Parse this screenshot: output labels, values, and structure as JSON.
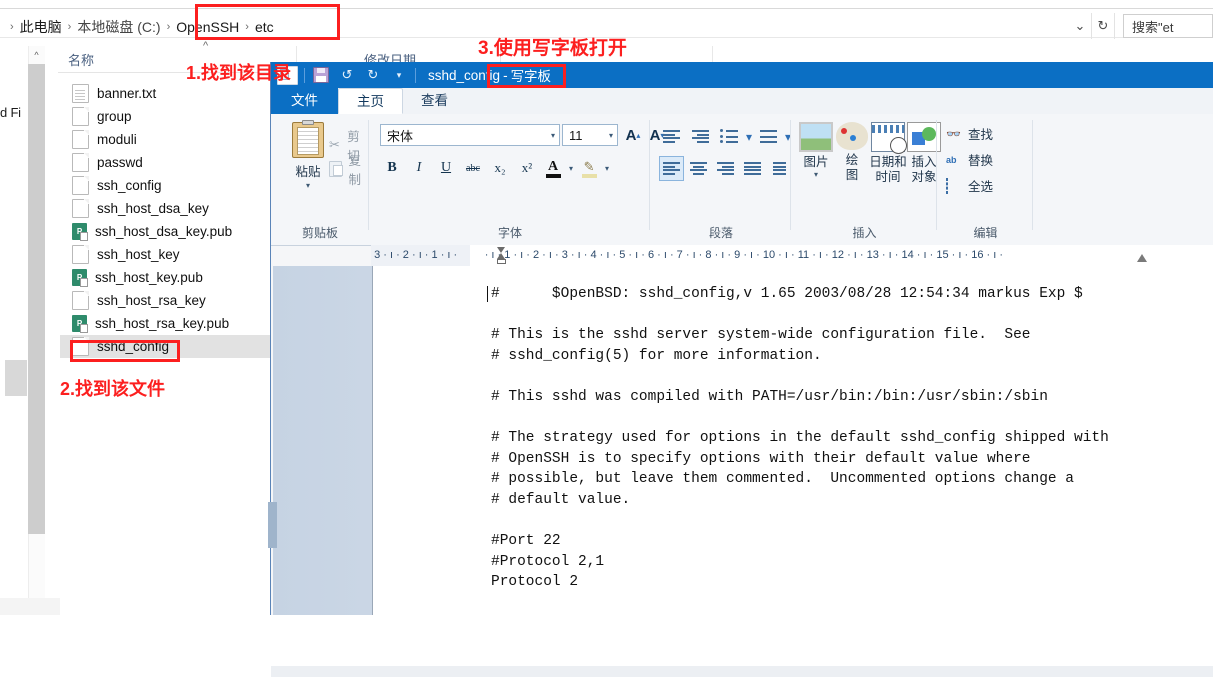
{
  "explorer": {
    "breadcrumb": {
      "leading_sep": "›",
      "items": [
        {
          "label": "此电脑",
          "sep": "›"
        },
        {
          "label": "本地磁盘 (C:)",
          "sep": "›"
        },
        {
          "label": "OpenSSH",
          "sep": "›"
        },
        {
          "label": "etc",
          "sep": ""
        }
      ]
    },
    "address_dropdown_icon": "chevron-down-icon",
    "refresh_icon": "refresh-icon",
    "search": {
      "value": "搜索\"et",
      "placeholder": "搜索\"etc\""
    },
    "columns": {
      "name": "名称",
      "date_modified": "修改日期",
      "sort_caret": "^"
    },
    "nav_partial_text": "d Fi",
    "scroll_up_caret": "^",
    "files": [
      {
        "name": "banner.txt",
        "icon": "text-file-icon",
        "selected": false
      },
      {
        "name": "group",
        "icon": "blank-file-icon",
        "selected": false
      },
      {
        "name": "moduli",
        "icon": "blank-file-icon",
        "selected": false
      },
      {
        "name": "passwd",
        "icon": "blank-file-icon",
        "selected": false
      },
      {
        "name": "ssh_config",
        "icon": "blank-file-icon",
        "selected": false
      },
      {
        "name": "ssh_host_dsa_key",
        "icon": "blank-file-icon",
        "selected": false
      },
      {
        "name": "ssh_host_dsa_key.pub",
        "icon": "pub-file-icon",
        "selected": false
      },
      {
        "name": "ssh_host_key",
        "icon": "blank-file-icon",
        "selected": false
      },
      {
        "name": "ssh_host_key.pub",
        "icon": "pub-file-icon",
        "selected": false
      },
      {
        "name": "ssh_host_rsa_key",
        "icon": "blank-file-icon",
        "selected": false
      },
      {
        "name": "ssh_host_rsa_key.pub",
        "icon": "pub-file-icon",
        "selected": false
      },
      {
        "name": "sshd_config",
        "icon": "blank-file-icon",
        "selected": true
      }
    ]
  },
  "wordpad": {
    "title_doc": "sshd_config",
    "title_sep": " - ",
    "title_app": "写字板",
    "quick_access": {
      "save_icon": "save-icon",
      "undo_icon": "undo-icon",
      "redo_icon": "redo-icon",
      "customize_icon": "chevron-down-icon",
      "undo_glyph": "↺",
      "redo_glyph": "↻",
      "customize_glyph": "▾"
    },
    "tabs": [
      {
        "label": "文件",
        "kind": "file"
      },
      {
        "label": "主页",
        "kind": "active"
      },
      {
        "label": "查看",
        "kind": "normal"
      }
    ],
    "ribbon": {
      "clipboard": {
        "group_label": "剪贴板",
        "paste": "粘贴",
        "paste_caret": "▾",
        "cut": "剪切",
        "cut_glyph": "✂",
        "copy": "复制"
      },
      "font": {
        "group_label": "字体",
        "font_family_value": "宋体",
        "font_size_value": "11",
        "caret": "▾",
        "grow_label": "A",
        "shrink_label": "A",
        "bold": "B",
        "italic": "I",
        "underline": "U",
        "strikethrough": "abc",
        "subscript": "x₂",
        "superscript": "x²",
        "text_color": "A",
        "highlight_glyph": "🖊",
        "small_caret": "▾"
      },
      "paragraph": {
        "group_label": "段落",
        "decrease_indent_icon": "decrease-indent-icon",
        "increase_indent_icon": "increase-indent-icon",
        "bullets_icon": "bullet-list-icon",
        "line_spacing_icon": "line-spacing-icon",
        "align_left_icon": "align-left-icon",
        "align_center_icon": "align-center-icon",
        "align_right_icon": "align-right-icon",
        "align_justify_icon": "align-justify-icon",
        "paragraph_settings_icon": "paragraph-settings-icon",
        "caret": "▾"
      },
      "insert": {
        "group_label": "插入",
        "items": [
          {
            "label": "图片",
            "caret": "▾",
            "icon": "picture-icon"
          },
          {
            "label": "绘\n图",
            "icon": "paint-drawing-icon"
          },
          {
            "label": "日期和\n时间",
            "icon": "date-time-icon"
          },
          {
            "label": "插入\n对象",
            "icon": "insert-object-icon"
          }
        ],
        "picture_label": "图片",
        "picture_caret": "▾",
        "paint_label_1": "绘",
        "paint_label_2": "图",
        "date_label_1": "日期和",
        "date_label_2": "时间",
        "object_label_1": "插入",
        "object_label_2": "对象"
      },
      "editing": {
        "group_label": "编辑",
        "find": "查找",
        "find_glyph": "🔍",
        "replace": "替换",
        "replace_glyph": "ab",
        "select_all": "全选"
      }
    },
    "ruler": {
      "left_labels": [
        "3",
        "2",
        "1"
      ],
      "right_labels": [
        "1",
        "2",
        "3",
        "4",
        "5",
        "6",
        "7",
        "8",
        "9",
        "10",
        "11",
        "12",
        "13",
        "14",
        "15",
        "16"
      ],
      "tick_glyph": "·",
      "minor_glyph": "ı"
    },
    "document": {
      "lines": [
        "#\t$OpenBSD: sshd_config,v 1.65 2003/08/28 12:54:34 markus Exp $",
        "",
        "# This is the sshd server system-wide configuration file.  See",
        "# sshd_config(5) for more information.",
        "",
        "# This sshd was compiled with PATH=/usr/bin:/bin:/usr/sbin:/sbin",
        "",
        "# The strategy used for options in the default sshd_config shipped with",
        "# OpenSSH is to specify options with their default value where",
        "# possible, but leave them commented.  Uncommented options change a",
        "# default value.",
        "",
        "#Port 22",
        "#Protocol 2,1",
        "Protocol 2"
      ],
      "text": "#      $OpenBSD: sshd_config,v 1.65 2003/08/28 12:54:34 markus Exp $\n\n# This is the sshd server system-wide configuration file.  See\n# sshd_config(5) for more information.\n\n# This sshd was compiled with PATH=/usr/bin:/bin:/usr/sbin:/sbin\n\n# The strategy used for options in the default sshd_config shipped with\n# OpenSSH is to specify options with their default value where\n# possible, but leave them commented.  Uncommented options change a\n# default value.\n\n#Port 22\n#Protocol 2,1\nProtocol 2"
    }
  },
  "annotations": {
    "step1": "1.找到该目录",
    "step2": "2.找到该文件",
    "step3": "3.使用写字板打开",
    "color": "#fc1f1f"
  }
}
